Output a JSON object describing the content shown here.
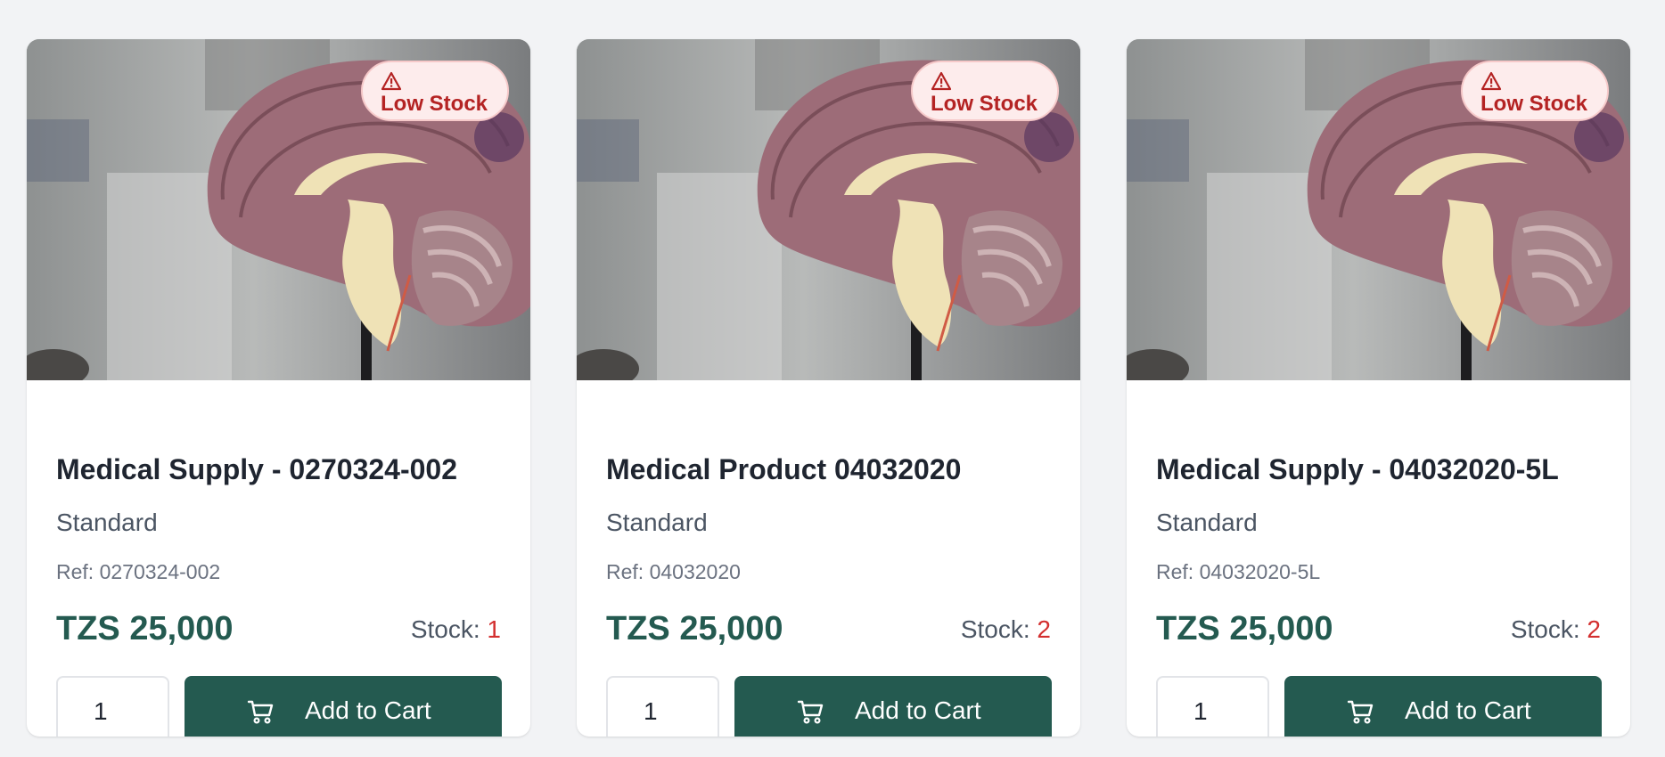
{
  "products": [
    {
      "badge": "Low Stock",
      "badge_icon": "warning-triangle-icon",
      "name": "Medical Supply - 0270324-002",
      "variant": "Standard",
      "ref": "Ref: 0270324-002",
      "price": "TZS 25,000",
      "stock_label": "Stock: ",
      "stock_qty": "1",
      "quantity": "1",
      "button_label": "Add to Cart",
      "button_icon": "shopping-cart-icon"
    },
    {
      "badge": "Low Stock",
      "badge_icon": "warning-triangle-icon",
      "name": "Medical Product 04032020",
      "variant": "Standard",
      "ref": "Ref: 04032020",
      "price": "TZS 25,000",
      "stock_label": "Stock: ",
      "stock_qty": "2",
      "quantity": "1",
      "button_label": "Add to Cart",
      "button_icon": "shopping-cart-icon"
    },
    {
      "badge": "Low Stock",
      "badge_icon": "warning-triangle-icon",
      "name": "Medical Supply - 04032020-5L",
      "variant": "Standard",
      "ref": "Ref: 04032020-5L",
      "price": "TZS 25,000",
      "stock_label": "Stock: ",
      "stock_qty": "2",
      "quantity": "1",
      "button_label": "Add to Cart",
      "button_icon": "shopping-cart-icon"
    }
  ],
  "colors": {
    "primary": "#245a50",
    "badge_bg": "#fdecec",
    "badge_text": "#b42323",
    "stock_low": "#d32f2f",
    "page_bg": "#f2f3f5"
  }
}
